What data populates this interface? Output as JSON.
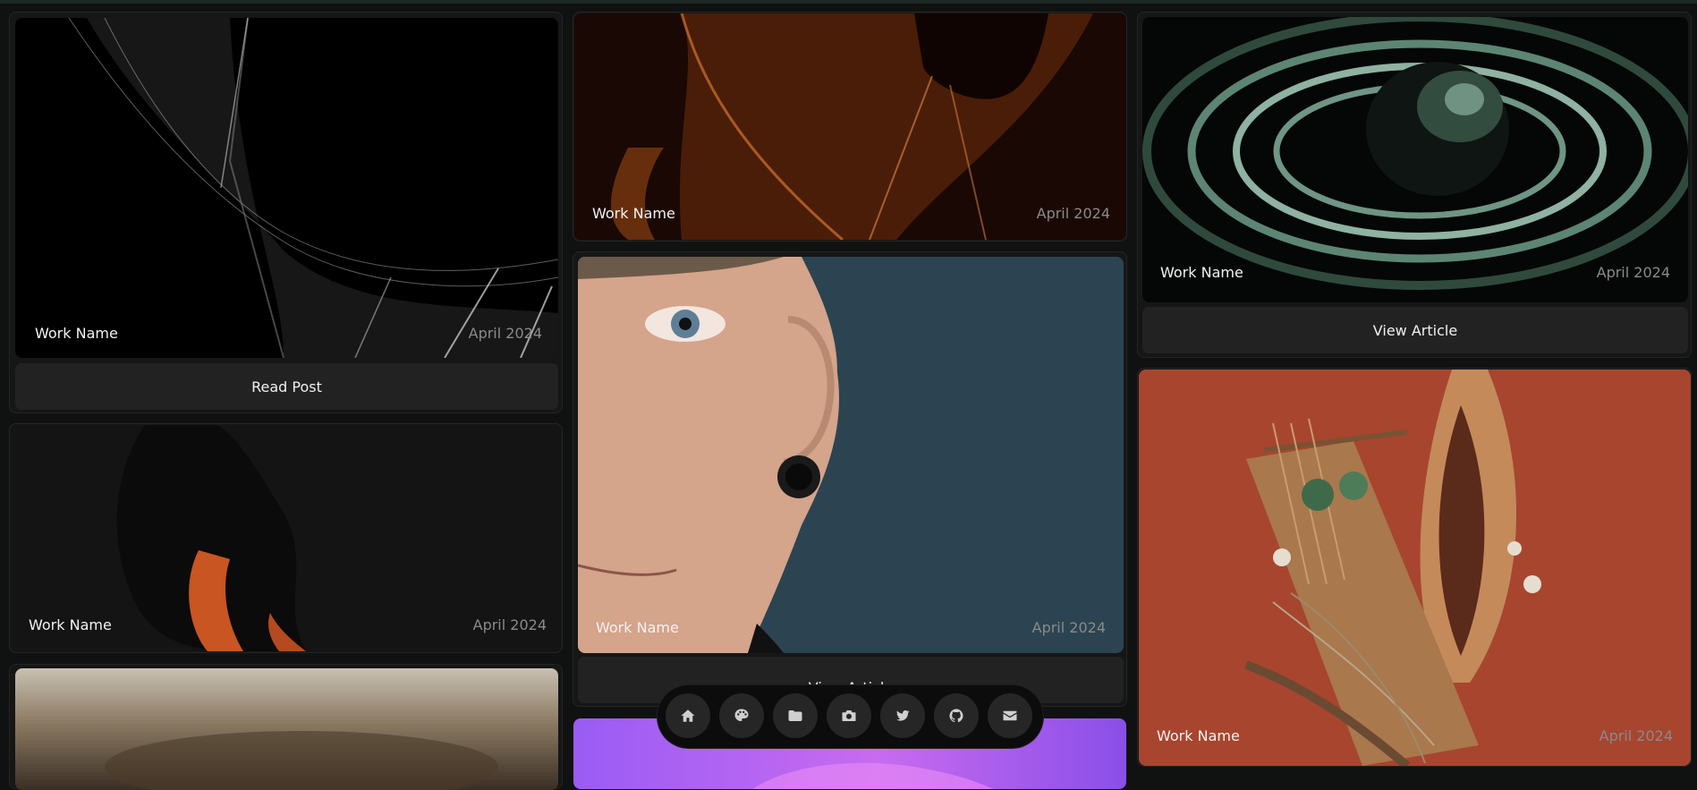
{
  "cards": [
    {
      "name": "Work Name",
      "date": "April 2024",
      "action": "Read Post"
    },
    {
      "name": "Work Name",
      "date": "April 2024"
    },
    {
      "name": "Work Name",
      "date": "April 2024"
    },
    {
      "name": "Work Name",
      "date": "April 2024",
      "action": "View Article"
    },
    {
      "name": "Work Name",
      "date": "April 2024",
      "action": "View Article"
    },
    {
      "name": "Work Name",
      "date": "April 2024"
    }
  ],
  "dock": {
    "items": [
      "home-icon",
      "palette-icon",
      "folder-icon",
      "camera-icon",
      "twitter-icon",
      "github-icon",
      "mail-icon"
    ]
  },
  "colors": {
    "background": "#101211",
    "card": "#161616",
    "button": "#222222",
    "date_text": "#8a8a8a"
  }
}
